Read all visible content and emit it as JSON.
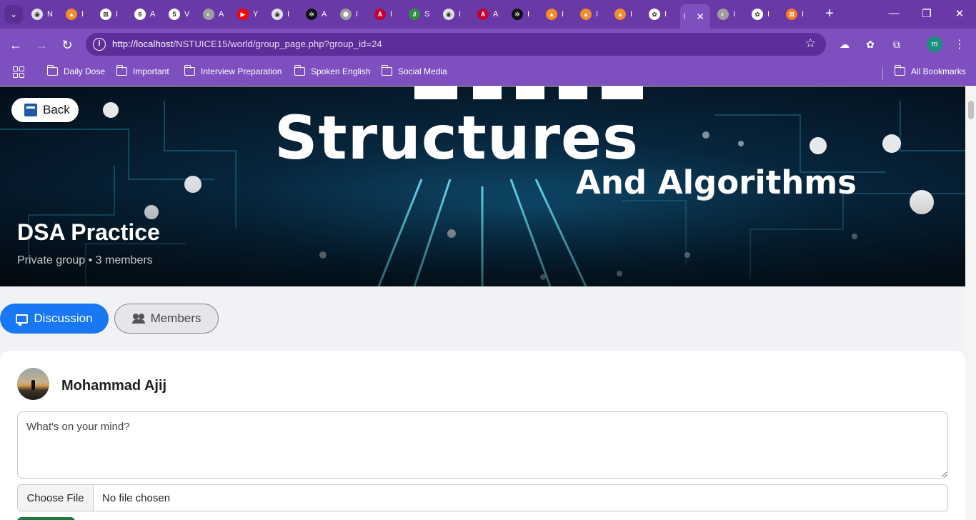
{
  "browser": {
    "tabs": [
      {
        "icon": "chrome-icon",
        "color": "#dfe1e5",
        "glyph": "◉",
        "title": "N"
      },
      {
        "icon": "tesla-icon",
        "color": "#f28c28",
        "glyph": "▲",
        "title": "I"
      },
      {
        "icon": "grid-app-icon",
        "color": "#ffffff",
        "glyph": "⊠",
        "title": "I"
      },
      {
        "icon": "circle-6-icon",
        "color": "#ffffff",
        "glyph": "6",
        "title": "A"
      },
      {
        "icon": "circle-5-icon",
        "color": "#ffffff",
        "glyph": "5",
        "title": "V"
      },
      {
        "icon": "globe-icon",
        "color": "#9e9e9e",
        "glyph": "◐",
        "title": "A"
      },
      {
        "icon": "youtube-icon",
        "color": "#ff0000",
        "glyph": "▶",
        "title": "Y"
      },
      {
        "icon": "chrome-icon",
        "color": "#dfe1e5",
        "glyph": "◉",
        "title": "I"
      },
      {
        "icon": "openai-icon",
        "color": "#111111",
        "glyph": "✲",
        "title": "A"
      },
      {
        "icon": "hexagon-icon",
        "color": "#9e9e9e",
        "glyph": "⬢",
        "title": "I"
      },
      {
        "icon": "angular-icon",
        "color": "#c3002f",
        "glyph": "A",
        "title": "I"
      },
      {
        "icon": "geeksforgeeks-icon",
        "color": "#2f8d46",
        "glyph": "∂",
        "title": "S"
      },
      {
        "icon": "chrome-icon",
        "color": "#dfe1e5",
        "glyph": "◉",
        "title": "I"
      },
      {
        "icon": "angular-icon",
        "color": "#c3002f",
        "glyph": "A",
        "title": "A"
      },
      {
        "icon": "openai-icon",
        "color": "#111111",
        "glyph": "✲",
        "title": "I"
      },
      {
        "icon": "tesla-icon",
        "color": "#f28c28",
        "glyph": "▲",
        "title": "I"
      },
      {
        "icon": "tesla-icon",
        "color": "#f28c28",
        "glyph": "▲",
        "title": "I"
      },
      {
        "icon": "tesla-icon",
        "color": "#f28c28",
        "glyph": "▲",
        "title": "I"
      },
      {
        "icon": "app-icon",
        "color": "#ffffff",
        "glyph": "✿",
        "title": "I"
      },
      {
        "icon": "active-tab",
        "color": "#7e4fbf",
        "glyph": "",
        "title": "I",
        "active": true
      },
      {
        "icon": "globe-icon",
        "color": "#9e9e9e",
        "glyph": "◐",
        "title": "I"
      },
      {
        "icon": "app-icon",
        "color": "#ffffff",
        "glyph": "✿",
        "title": "I"
      },
      {
        "icon": "xampp-icon",
        "color": "#fb7a24",
        "glyph": "⊠",
        "title": "I"
      }
    ],
    "url_host": "http://localhost",
    "url_path": "/NSTUICE15/world/group_page.php?group_id=24",
    "profile_initial": "m",
    "bookmarks": [
      "Daily Dose",
      "Important",
      "Interview Preparation",
      "Spoken English",
      "Social Media"
    ],
    "all_bookmarks": "All Bookmarks"
  },
  "cover": {
    "back_label": "Back",
    "banner_line1": "Structures",
    "banner_line2": "And Algorithms",
    "group_name": "DSA Practice",
    "group_meta": "Private group • 3 members"
  },
  "tabs": {
    "discussion": "Discussion",
    "members": "Members"
  },
  "composer": {
    "user_name": "Mohammad Ajij",
    "placeholder": "What's on your mind?",
    "file_button": "Choose File",
    "file_status": "No file chosen"
  },
  "colors": {
    "browser_frame": "#6a39a8",
    "toolbar": "#7e4fbf",
    "primary": "#1877f2",
    "post_button": "#1f7a3f"
  }
}
